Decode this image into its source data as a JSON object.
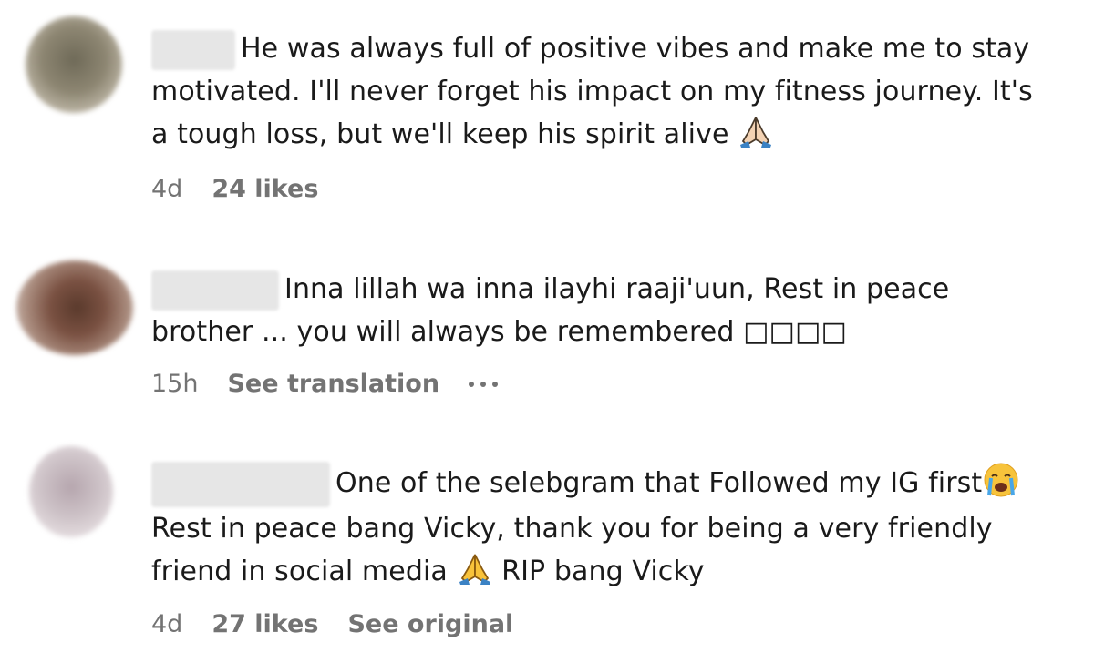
{
  "comments": [
    {
      "text_line1": "He was always full of positive vibes and make me to stay",
      "text_rest": "motivated. I'll never forget his impact on my fitness journey. It's\na tough loss, but we'll keep his spirit alive ",
      "time": "4d",
      "likes": "24 likes",
      "emoji_icon": "folded-hands-light-skin",
      "avatar_color": "#8a8270"
    },
    {
      "text_line1": "Inna lillah wa inna ilayhi raaji'uun, Rest in peace",
      "text_rest": "brother ... you will always be remembered ",
      "missing_glyphs": "□□□□",
      "time": "15h",
      "see_translation": "See translation",
      "avatar_color": "#7a5848"
    },
    {
      "text_line1": "One of the selebgram that Followed my IG first",
      "text_line2": "Rest in peace bang Vicky, thank you for being a very friendly",
      "text_line3_a": "friend in social media ",
      "text_line3_b": " RIP bang Vicky",
      "time": "4d",
      "likes": "27 likes",
      "see_original": "See original",
      "avatar_color": "#c8bcc2"
    }
  ]
}
